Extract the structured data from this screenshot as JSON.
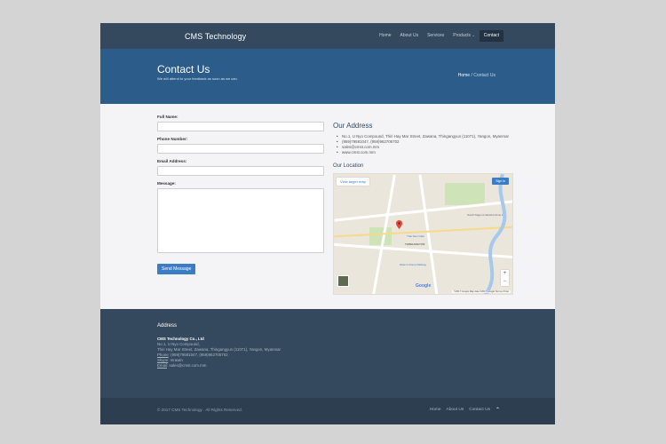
{
  "brand": "CMS Technology",
  "nav": {
    "items": [
      "Home",
      "About Us",
      "Services",
      "Products",
      "Contact"
    ],
    "products_chevron": "⌄"
  },
  "hero": {
    "title": "Contact Us",
    "subtitle": "We will attend to your feedback as soon as we can.",
    "breadcrumb_home": "Home",
    "breadcrumb_sep": "/",
    "breadcrumb_current": "Contact Us"
  },
  "form": {
    "full_name_label": "Full Name:",
    "phone_label": "Phone Number:",
    "email_label": "Email Address:",
    "message_label": "Message:",
    "send_label": "Send Message"
  },
  "address": {
    "heading": "Our Address",
    "lines": [
      "No.1, U Nyo Compound, Thiri Hay Mar Street, Zawana, Thingangyun (11071), Yangon, Myanmar",
      "(959)79581047, (959)962705702",
      "sales@cmst.com.mm",
      "www.cmst.com.mm"
    ],
    "location_heading": "Our Location"
  },
  "map": {
    "view_larger": "View larger map",
    "sign_in": "Sign in",
    "footer": "©2017 Google   Map data ©2017 Google   Terms of Use",
    "google": "Google",
    "zoom_in": "+",
    "zoom_out": "−",
    "labels": [
      "South Dagon Industrial Zone 1",
      "THINGANGYUN",
      "Thai Sein Café",
      "Hlaw G Dome Railway"
    ]
  },
  "footer": {
    "heading": "Address",
    "company": "CMS Technology Co., Ltd",
    "line1": "No.1, U Nyo Compound,",
    "line2": "Thiri Hay Mar Street, Zawana, Thingangyun (11071), Yangon, Myanmar",
    "phone_label": "Phone",
    "phone": ": (959)79581047, (959)962705702",
    "skype_label": "Skype",
    "skype": ": mrawin",
    "email_label": "Email",
    "email": ": sales@cmst.com.mm"
  },
  "bottom": {
    "copyright": "© 2017 CMS Technology . All Rights Reserved.",
    "links": [
      "Home",
      "About Us",
      "Contact Us"
    ],
    "up": "⌃"
  },
  "colors": {
    "nav": "#34495e",
    "hero": "#2c5c8a",
    "accent": "#3a7dc5",
    "footer": "#34495e",
    "bottom": "#2c3e50"
  }
}
